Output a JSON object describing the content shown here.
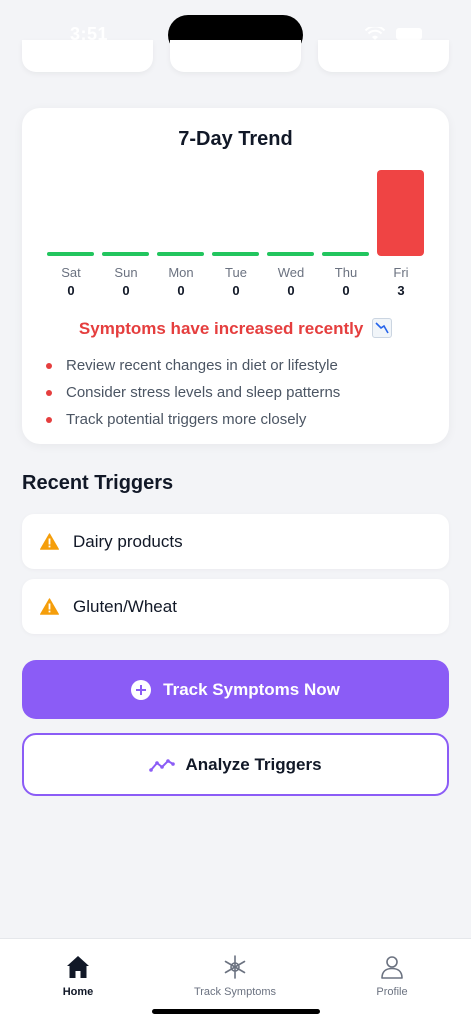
{
  "status_bar": {
    "time": "3:51"
  },
  "trend_card": {
    "title": "7-Day Trend",
    "alert": "Symptoms have increased recently",
    "recommendations": [
      "Review recent changes in diet or lifestyle",
      "Consider stress levels and sleep patterns",
      "Track potential triggers more closely"
    ]
  },
  "chart_data": {
    "type": "bar",
    "categories": [
      "Sat",
      "Sun",
      "Mon",
      "Tue",
      "Wed",
      "Thu",
      "Fri"
    ],
    "values": [
      0,
      0,
      0,
      0,
      0,
      0,
      3
    ],
    "zero_color": "#22c55e",
    "positive_color": "#ef4444",
    "ylim": [
      0,
      3
    ]
  },
  "recent_triggers": {
    "title": "Recent Triggers",
    "items": [
      {
        "label": "Dairy products",
        "icon": "warning-icon"
      },
      {
        "label": "Gluten/Wheat",
        "icon": "warning-icon"
      }
    ]
  },
  "actions": {
    "track_label": "Track Symptoms Now",
    "analyze_label": "Analyze Triggers"
  },
  "tab_bar": {
    "items": [
      {
        "label": "Home",
        "icon": "home-icon",
        "active": true
      },
      {
        "label": "Track Symptoms",
        "icon": "asterisk-icon",
        "active": false
      },
      {
        "label": "Profile",
        "icon": "person-icon",
        "active": false
      }
    ]
  },
  "colors": {
    "accent": "#8b5cf6",
    "alert": "#e53e3e",
    "warning": "#f59e0b"
  }
}
